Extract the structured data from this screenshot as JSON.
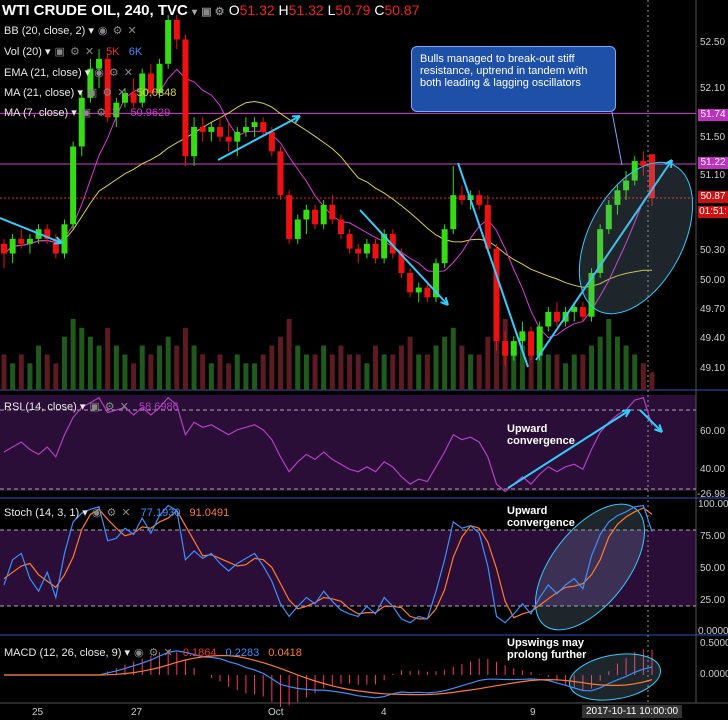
{
  "header": {
    "symbol": "WTI CRUDE OIL, 240, TVC",
    "o_label": "O",
    "o": "51.32",
    "h_label": "H",
    "h": "51.32",
    "l_label": "L",
    "l": "50.79",
    "c_label": "C",
    "c": "50.87"
  },
  "legend": {
    "bb": "BB (20, close, 2)",
    "vol": "Vol (20)",
    "vol_v1": "5K",
    "vol_v2": "6K",
    "ema": "EMA (21, close)",
    "ma21": "MA (21, close)",
    "ma21_val": "50.0848",
    "ma7": "MA (7, close)",
    "ma7_val": "50.9629"
  },
  "callout": "Bulls managed to break-out stiff resistance, uptrend in tandem with both leading & lagging oscillators",
  "price_axis": {
    "ticks": [
      "52.50",
      "52.10",
      "51.74",
      "51.50",
      "51.22",
      "51.10",
      "50.87",
      "01:51:",
      "50.30",
      "50.00",
      "49.70",
      "49.40",
      "49.10"
    ],
    "tag_51_74": "51.74",
    "tag_51_22": "51.22",
    "tag_close": "50.87",
    "tag_timer": "01:51:"
  },
  "rsi": {
    "label": "RSI (14, close)",
    "value": "58.6986",
    "ticks": [
      "60.00",
      "40.00",
      "-26.98"
    ],
    "annotation": "Upward convergence"
  },
  "stoch": {
    "label": "Stoch (14, 3, 1)",
    "k": "77.1930",
    "d": "91.0491",
    "ticks": [
      "100.00",
      "75.00",
      "50.00",
      "25.00",
      "0.0000"
    ],
    "annotation": "Upward convergence"
  },
  "macd": {
    "label": "MACD (12, 26, close, 9)",
    "hist": "0.1864",
    "macd": "0.2283",
    "signal": "0.0418",
    "ticks": [
      "0.5000",
      "0.0000"
    ],
    "annotation": "Upswings may prolong further"
  },
  "time_axis": {
    "labels": [
      "25",
      "27",
      "Oct",
      "4",
      "9",
      "11"
    ],
    "cursor": "2017-10-11  10:00:00"
  },
  "colors": {
    "up": "#33dd11",
    "down": "#ee1111",
    "ma7": "#dd33dd",
    "ma21": "#e0d040",
    "hline": "#d040d0",
    "arrow": "#33ccff",
    "stoch_k": "#3a8fff",
    "stoch_d": "#ff7a30",
    "rsi": "#b040c0",
    "macd": "#3a8fff",
    "signal": "#ff7a30"
  },
  "chart_data": {
    "type": "candlestick",
    "ylim": [
      49.0,
      52.7
    ],
    "horizontal_levels": [
      51.74,
      51.22,
      50.87
    ],
    "candles": [
      [
        50.4,
        50.45,
        50.15,
        50.3
      ],
      [
        50.3,
        50.5,
        50.2,
        50.45
      ],
      [
        50.45,
        50.55,
        50.35,
        50.4
      ],
      [
        50.4,
        50.5,
        50.3,
        50.45
      ],
      [
        50.45,
        50.6,
        50.4,
        50.55
      ],
      [
        50.55,
        50.6,
        50.4,
        50.45
      ],
      [
        50.45,
        50.5,
        50.25,
        50.3
      ],
      [
        50.3,
        50.65,
        50.25,
        50.6
      ],
      [
        50.6,
        51.45,
        50.55,
        51.4
      ],
      [
        51.4,
        51.95,
        51.3,
        51.9
      ],
      [
        51.9,
        52.3,
        51.85,
        52.2
      ],
      [
        52.2,
        52.4,
        52.0,
        52.3
      ],
      [
        52.3,
        52.35,
        51.65,
        51.7
      ],
      [
        51.7,
        51.9,
        51.6,
        51.85
      ],
      [
        51.85,
        52.0,
        51.8,
        51.95
      ],
      [
        51.95,
        52.1,
        51.8,
        51.85
      ],
      [
        51.85,
        52.2,
        51.8,
        52.15
      ],
      [
        52.15,
        52.25,
        51.9,
        51.95
      ],
      [
        51.95,
        52.3,
        51.9,
        52.25
      ],
      [
        52.25,
        52.75,
        52.2,
        52.7
      ],
      [
        52.7,
        52.75,
        52.4,
        52.5
      ],
      [
        52.5,
        52.55,
        51.2,
        51.3
      ],
      [
        51.3,
        51.7,
        51.2,
        51.6
      ],
      [
        51.6,
        51.7,
        51.45,
        51.55
      ],
      [
        51.55,
        51.65,
        51.45,
        51.6
      ],
      [
        51.6,
        51.7,
        51.45,
        51.5
      ],
      [
        51.5,
        51.65,
        51.35,
        51.45
      ],
      [
        51.45,
        51.6,
        51.3,
        51.55
      ],
      [
        51.55,
        51.7,
        51.5,
        51.6
      ],
      [
        51.6,
        51.7,
        51.5,
        51.65
      ],
      [
        51.65,
        51.7,
        51.5,
        51.55
      ],
      [
        51.55,
        51.6,
        51.3,
        51.35
      ],
      [
        51.35,
        51.4,
        50.85,
        50.9
      ],
      [
        50.9,
        50.95,
        50.4,
        50.45
      ],
      [
        50.45,
        50.7,
        50.4,
        50.65
      ],
      [
        50.65,
        50.8,
        50.5,
        50.75
      ],
      [
        50.75,
        50.8,
        50.55,
        50.6
      ],
      [
        50.6,
        50.85,
        50.55,
        50.8
      ],
      [
        50.8,
        50.9,
        50.6,
        50.65
      ],
      [
        50.65,
        50.7,
        50.45,
        50.5
      ],
      [
        50.5,
        50.55,
        50.3,
        50.35
      ],
      [
        50.35,
        50.4,
        50.2,
        50.3
      ],
      [
        50.3,
        50.45,
        50.25,
        50.4
      ],
      [
        50.4,
        50.45,
        50.2,
        50.25
      ],
      [
        50.25,
        50.55,
        50.2,
        50.5
      ],
      [
        50.5,
        50.55,
        50.25,
        50.3
      ],
      [
        50.3,
        50.35,
        50.05,
        50.1
      ],
      [
        50.1,
        50.15,
        49.85,
        49.9
      ],
      [
        49.9,
        50.0,
        49.8,
        49.95
      ],
      [
        49.95,
        50.0,
        49.8,
        49.85
      ],
      [
        49.85,
        50.25,
        49.8,
        50.2
      ],
      [
        50.2,
        50.6,
        50.15,
        50.55
      ],
      [
        50.55,
        51.2,
        50.5,
        50.9
      ],
      [
        50.9,
        51.0,
        50.8,
        50.85
      ],
      [
        50.85,
        50.95,
        50.75,
        50.9
      ],
      [
        50.9,
        50.95,
        50.75,
        50.8
      ],
      [
        50.8,
        50.9,
        50.3,
        50.35
      ],
      [
        50.35,
        50.4,
        49.3,
        49.4
      ],
      [
        49.4,
        49.5,
        49.15,
        49.25
      ],
      [
        49.25,
        49.45,
        49.2,
        49.4
      ],
      [
        49.4,
        49.6,
        49.3,
        49.5
      ],
      [
        49.5,
        49.55,
        49.2,
        49.25
      ],
      [
        49.25,
        49.6,
        49.2,
        49.55
      ],
      [
        49.55,
        49.75,
        49.5,
        49.7
      ],
      [
        49.7,
        49.8,
        49.55,
        49.6
      ],
      [
        49.6,
        49.75,
        49.55,
        49.7
      ],
      [
        49.7,
        49.8,
        49.6,
        49.75
      ],
      [
        49.75,
        49.8,
        49.6,
        49.65
      ],
      [
        49.65,
        50.15,
        49.6,
        50.1
      ],
      [
        50.1,
        50.6,
        50.05,
        50.55
      ],
      [
        50.55,
        50.85,
        50.5,
        50.8
      ],
      [
        50.8,
        51.0,
        50.7,
        50.95
      ],
      [
        50.95,
        51.15,
        50.85,
        51.05
      ],
      [
        51.05,
        51.3,
        51.0,
        51.25
      ],
      [
        51.25,
        51.35,
        51.1,
        51.2
      ],
      [
        51.32,
        51.32,
        50.79,
        50.87
      ]
    ],
    "volume": [
      4,
      3,
      4,
      3,
      5,
      4,
      3,
      6,
      8,
      7,
      6,
      5,
      7,
      5,
      4,
      3,
      5,
      4,
      5,
      6,
      5,
      7,
      5,
      4,
      3,
      4,
      3,
      4,
      3,
      3,
      4,
      5,
      6,
      8,
      5,
      4,
      4,
      5,
      4,
      5,
      4,
      4,
      3,
      5,
      4,
      4,
      5,
      6,
      4,
      4,
      5,
      6,
      7,
      5,
      4,
      4,
      6,
      9,
      8,
      5,
      5,
      6,
      5,
      4,
      4,
      3,
      4,
      4,
      5,
      6,
      8,
      6,
      5,
      4,
      3,
      2
    ],
    "rsi": [
      48,
      50,
      52,
      49,
      47,
      50,
      46,
      55,
      62,
      66,
      68,
      70,
      64,
      65,
      66,
      63,
      66,
      63,
      66,
      70,
      67,
      55,
      60,
      58,
      59,
      57,
      55,
      57,
      58,
      59,
      57,
      53,
      46,
      40,
      44,
      47,
      45,
      48,
      45,
      43,
      41,
      40,
      42,
      40,
      44,
      42,
      38,
      35,
      37,
      36,
      42,
      48,
      55,
      53,
      54,
      52,
      46,
      35,
      32,
      35,
      38,
      35,
      39,
      42,
      40,
      42,
      43,
      41,
      49,
      56,
      60,
      63,
      65,
      69,
      70,
      58.7
    ],
    "stoch_k": [
      35,
      55,
      60,
      40,
      30,
      45,
      25,
      60,
      85,
      92,
      95,
      97,
      70,
      72,
      80,
      75,
      88,
      76,
      90,
      98,
      94,
      55,
      62,
      56,
      60,
      52,
      46,
      52,
      56,
      60,
      50,
      38,
      20,
      10,
      18,
      25,
      20,
      30,
      22,
      15,
      12,
      10,
      18,
      12,
      25,
      18,
      8,
      5,
      10,
      8,
      30,
      55,
      85,
      80,
      82,
      76,
      50,
      10,
      5,
      12,
      20,
      12,
      25,
      35,
      28,
      35,
      40,
      32,
      58,
      75,
      85,
      90,
      93,
      97,
      98,
      77.2
    ],
    "stoch_d": [
      40,
      45,
      50,
      52,
      43,
      38,
      33,
      43,
      57,
      79,
      91,
      95,
      87,
      80,
      74,
      76,
      81,
      80,
      85,
      88,
      94,
      82,
      70,
      58,
      59,
      56,
      53,
      50,
      51,
      56,
      55,
      49,
      36,
      23,
      16,
      18,
      21,
      25,
      24,
      22,
      16,
      12,
      13,
      13,
      18,
      18,
      17,
      10,
      8,
      8,
      16,
      31,
      57,
      73,
      82,
      80,
      69,
      48,
      22,
      9,
      12,
      14,
      19,
      24,
      29,
      33,
      34,
      36,
      43,
      55,
      73,
      83,
      89,
      93,
      96,
      91.0
    ]
  }
}
